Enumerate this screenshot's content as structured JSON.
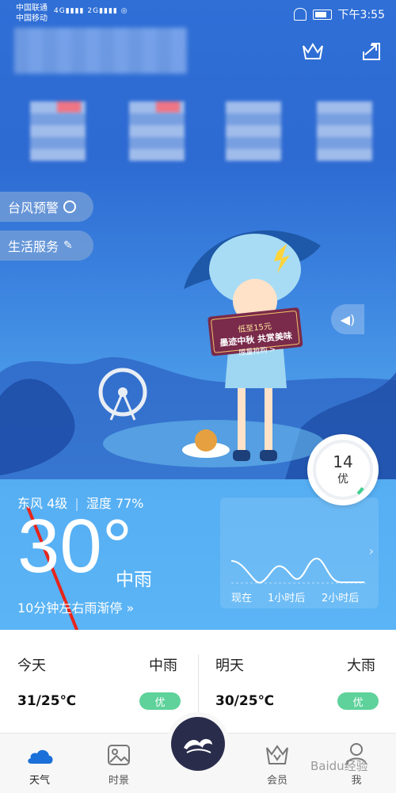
{
  "status_bar": {
    "carrier1": "中国联通",
    "carrier2": "中国移动",
    "net1": "4G",
    "net2": "2G",
    "time": "下午3:55"
  },
  "quick_buttons": {
    "typhoon": "台风预警",
    "life": "生活服务"
  },
  "promo": {
    "line1": "低至15元",
    "line2": "墨迹中秋 共赏美味",
    "line3": "限量抢购 >"
  },
  "aqi": {
    "value": "14",
    "level": "优"
  },
  "current": {
    "wind": "东风 4级",
    "humidity": "湿度 77%",
    "temperature": "30°",
    "condition": "中雨",
    "rain_note": "10分钟左右雨渐停",
    "rain_chevrons": "»"
  },
  "rain_chart": {
    "labels": [
      "现在",
      "1小时后",
      "2小时后"
    ]
  },
  "forecast": [
    {
      "day": "今天",
      "condition": "中雨",
      "temp": "31/25℃",
      "aqi": "优"
    },
    {
      "day": "明天",
      "condition": "大雨",
      "temp": "30/25℃",
      "aqi": "优"
    }
  ],
  "nav": {
    "weather": "天气",
    "scenery": "时景",
    "member": "会员",
    "me": "我"
  },
  "watermark": "Baidu经验",
  "colors": {
    "badge_green": "#5fd29b",
    "arrow_red": "#e8241a",
    "nav_active": "#1a6fd8"
  }
}
